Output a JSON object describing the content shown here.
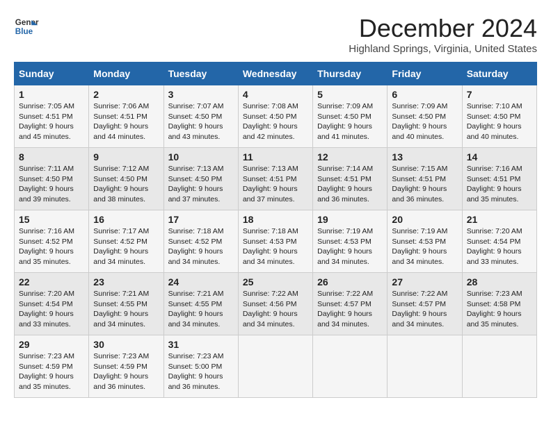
{
  "logo": {
    "line1": "General",
    "line2": "Blue"
  },
  "title": "December 2024",
  "location": "Highland Springs, Virginia, United States",
  "days_of_week": [
    "Sunday",
    "Monday",
    "Tuesday",
    "Wednesday",
    "Thursday",
    "Friday",
    "Saturday"
  ],
  "weeks": [
    [
      {
        "num": "1",
        "sunrise": "7:05 AM",
        "sunset": "4:51 PM",
        "daylight": "9 hours and 45 minutes."
      },
      {
        "num": "2",
        "sunrise": "7:06 AM",
        "sunset": "4:51 PM",
        "daylight": "9 hours and 44 minutes."
      },
      {
        "num": "3",
        "sunrise": "7:07 AM",
        "sunset": "4:50 PM",
        "daylight": "9 hours and 43 minutes."
      },
      {
        "num": "4",
        "sunrise": "7:08 AM",
        "sunset": "4:50 PM",
        "daylight": "9 hours and 42 minutes."
      },
      {
        "num": "5",
        "sunrise": "7:09 AM",
        "sunset": "4:50 PM",
        "daylight": "9 hours and 41 minutes."
      },
      {
        "num": "6",
        "sunrise": "7:09 AM",
        "sunset": "4:50 PM",
        "daylight": "9 hours and 40 minutes."
      },
      {
        "num": "7",
        "sunrise": "7:10 AM",
        "sunset": "4:50 PM",
        "daylight": "9 hours and 40 minutes."
      }
    ],
    [
      {
        "num": "8",
        "sunrise": "7:11 AM",
        "sunset": "4:50 PM",
        "daylight": "9 hours and 39 minutes."
      },
      {
        "num": "9",
        "sunrise": "7:12 AM",
        "sunset": "4:50 PM",
        "daylight": "9 hours and 38 minutes."
      },
      {
        "num": "10",
        "sunrise": "7:13 AM",
        "sunset": "4:50 PM",
        "daylight": "9 hours and 37 minutes."
      },
      {
        "num": "11",
        "sunrise": "7:13 AM",
        "sunset": "4:51 PM",
        "daylight": "9 hours and 37 minutes."
      },
      {
        "num": "12",
        "sunrise": "7:14 AM",
        "sunset": "4:51 PM",
        "daylight": "9 hours and 36 minutes."
      },
      {
        "num": "13",
        "sunrise": "7:15 AM",
        "sunset": "4:51 PM",
        "daylight": "9 hours and 36 minutes."
      },
      {
        "num": "14",
        "sunrise": "7:16 AM",
        "sunset": "4:51 PM",
        "daylight": "9 hours and 35 minutes."
      }
    ],
    [
      {
        "num": "15",
        "sunrise": "7:16 AM",
        "sunset": "4:52 PM",
        "daylight": "9 hours and 35 minutes."
      },
      {
        "num": "16",
        "sunrise": "7:17 AM",
        "sunset": "4:52 PM",
        "daylight": "9 hours and 34 minutes."
      },
      {
        "num": "17",
        "sunrise": "7:18 AM",
        "sunset": "4:52 PM",
        "daylight": "9 hours and 34 minutes."
      },
      {
        "num": "18",
        "sunrise": "7:18 AM",
        "sunset": "4:53 PM",
        "daylight": "9 hours and 34 minutes."
      },
      {
        "num": "19",
        "sunrise": "7:19 AM",
        "sunset": "4:53 PM",
        "daylight": "9 hours and 34 minutes."
      },
      {
        "num": "20",
        "sunrise": "7:19 AM",
        "sunset": "4:53 PM",
        "daylight": "9 hours and 34 minutes."
      },
      {
        "num": "21",
        "sunrise": "7:20 AM",
        "sunset": "4:54 PM",
        "daylight": "9 hours and 33 minutes."
      }
    ],
    [
      {
        "num": "22",
        "sunrise": "7:20 AM",
        "sunset": "4:54 PM",
        "daylight": "9 hours and 33 minutes."
      },
      {
        "num": "23",
        "sunrise": "7:21 AM",
        "sunset": "4:55 PM",
        "daylight": "9 hours and 34 minutes."
      },
      {
        "num": "24",
        "sunrise": "7:21 AM",
        "sunset": "4:55 PM",
        "daylight": "9 hours and 34 minutes."
      },
      {
        "num": "25",
        "sunrise": "7:22 AM",
        "sunset": "4:56 PM",
        "daylight": "9 hours and 34 minutes."
      },
      {
        "num": "26",
        "sunrise": "7:22 AM",
        "sunset": "4:57 PM",
        "daylight": "9 hours and 34 minutes."
      },
      {
        "num": "27",
        "sunrise": "7:22 AM",
        "sunset": "4:57 PM",
        "daylight": "9 hours and 34 minutes."
      },
      {
        "num": "28",
        "sunrise": "7:23 AM",
        "sunset": "4:58 PM",
        "daylight": "9 hours and 35 minutes."
      }
    ],
    [
      {
        "num": "29",
        "sunrise": "7:23 AM",
        "sunset": "4:59 PM",
        "daylight": "9 hours and 35 minutes."
      },
      {
        "num": "30",
        "sunrise": "7:23 AM",
        "sunset": "4:59 PM",
        "daylight": "9 hours and 36 minutes."
      },
      {
        "num": "31",
        "sunrise": "7:23 AM",
        "sunset": "5:00 PM",
        "daylight": "9 hours and 36 minutes."
      },
      null,
      null,
      null,
      null
    ]
  ],
  "labels": {
    "sunrise": "Sunrise:",
    "sunset": "Sunset:",
    "daylight": "Daylight:"
  },
  "colors": {
    "header_bg": "#2366a8"
  }
}
